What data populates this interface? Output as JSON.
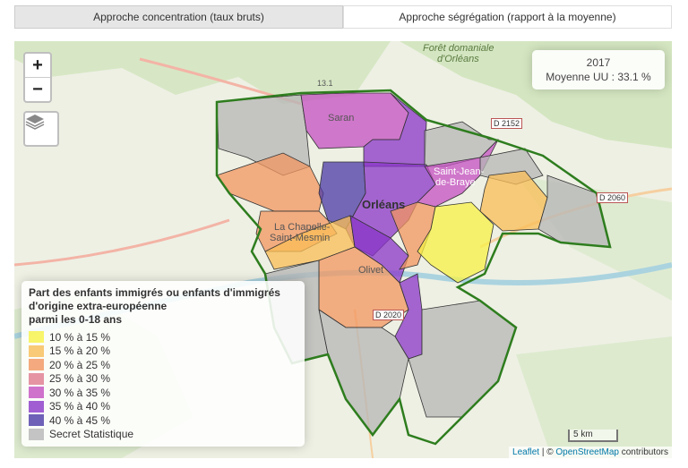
{
  "tabs": [
    {
      "label": "Approche concentration (taux bruts)",
      "active": true
    },
    {
      "label": "Approche ségrégation (rapport à la moyenne)",
      "active": false
    }
  ],
  "controls": {
    "zoom_in": "+",
    "zoom_out": "−",
    "layers_icon": "layers-icon"
  },
  "info": {
    "year": "2017",
    "average": "Moyenne UU : 33.1 %"
  },
  "map_labels": {
    "saran": "Saran",
    "orleans": "Orléans",
    "la_chapelle_1": "La Chapelle-",
    "la_chapelle_2": "Saint-Mesmin",
    "olivet": "Olivet",
    "saint_jean_1": "Saint-Jean-",
    "saint_jean_2": "de-Braye",
    "foret_1": "Forêt domaniale",
    "foret_2": "d'Orléans",
    "road_d2152": "D 2152",
    "road_d2060": "D 2060",
    "road_d2020": "D 2020",
    "road_n": "13.1"
  },
  "legend": {
    "title_1": "Part des enfants immigrés ou enfants d'immigrés",
    "title_2": "d'origine extra-européenne",
    "title_3": "parmi les 0-18 ans",
    "items": [
      {
        "label": "10 % à 15 %",
        "color": "#f7f246"
      },
      {
        "label": "15 % à 20 %",
        "color": "#f9bd56"
      },
      {
        "label": "20 % à 25 %",
        "color": "#f2955f"
      },
      {
        "label": "25 % à 30 %",
        "color": "#e0798f"
      },
      {
        "label": "30 % à 35 %",
        "color": "#c44fc1"
      },
      {
        "label": "35 % à 40 %",
        "color": "#8a36c8"
      },
      {
        "label": "40 % à 45 %",
        "color": "#4b3aa6"
      },
      {
        "label": "Secret Statistique",
        "color": "#b5b5b5"
      }
    ]
  },
  "scale": "5 km",
  "attribution": {
    "leaflet": "Leaflet",
    "sep": " | © ",
    "osm": "OpenStreetMap",
    "contributors": " contributors"
  }
}
